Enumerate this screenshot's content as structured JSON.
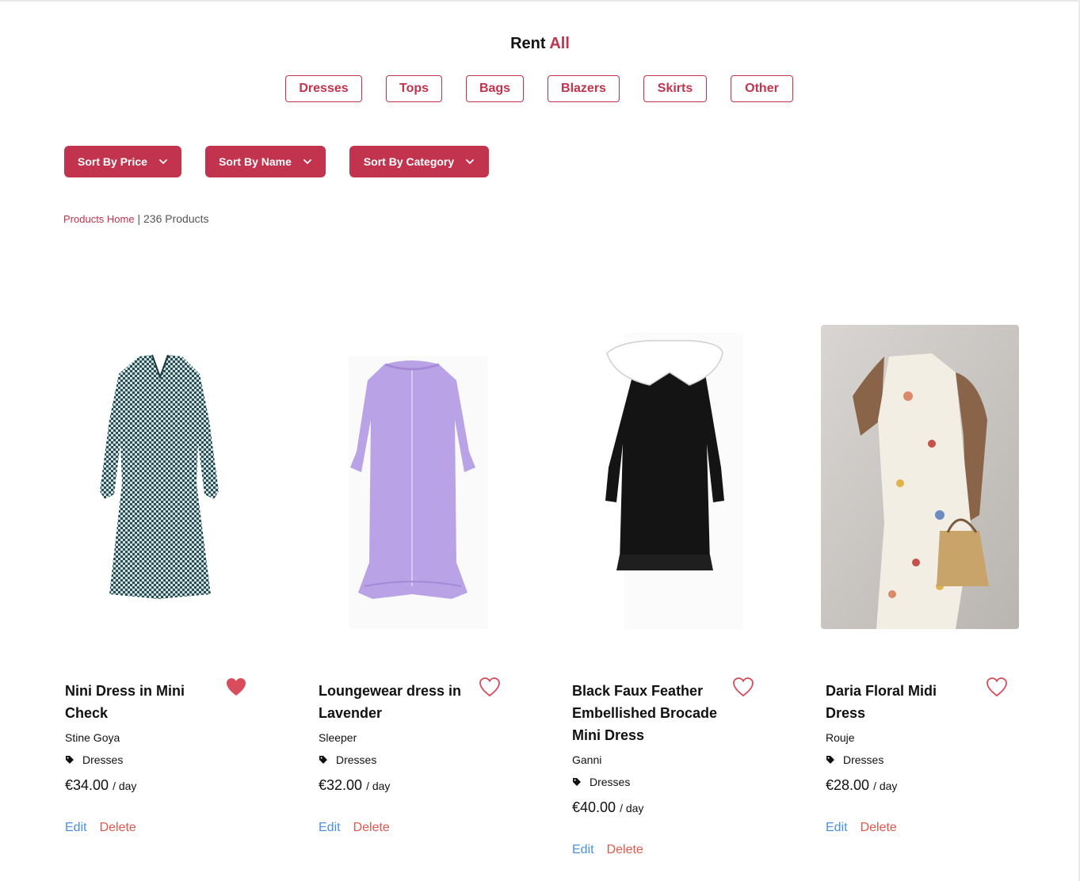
{
  "header": {
    "title_prefix": "Rent",
    "title_accent": "All"
  },
  "categories": [
    "Dresses",
    "Tops",
    "Bags",
    "Blazers",
    "Skirts",
    "Other"
  ],
  "sort": {
    "price": "Sort By Price",
    "name": "Sort By Name",
    "category": "Sort By Category"
  },
  "breadcrumb": {
    "home": "Products Home",
    "separator": "|",
    "count": "236 Products"
  },
  "colors": {
    "accent": "#c2334d",
    "edit": "#4a90e2",
    "delete": "#e2574c"
  },
  "products": [
    {
      "name": "Nini Dress in Mini Check",
      "brand": "Stine Goya",
      "category": "Dresses",
      "price": "€34.00",
      "per": "/ day",
      "favorited": true,
      "edit": "Edit",
      "delete": "Delete"
    },
    {
      "name": "Loungewear dress in Lavender",
      "brand": "Sleeper",
      "category": "Dresses",
      "price": "€32.00",
      "per": "/ day",
      "favorited": false,
      "edit": "Edit",
      "delete": "Delete"
    },
    {
      "name": "Black Faux Feather Embellished Brocade Mini Dress",
      "brand": "Ganni",
      "category": "Dresses",
      "price": "€40.00",
      "per": "/ day",
      "favorited": false,
      "edit": "Edit",
      "delete": "Delete"
    },
    {
      "name": "Daria Floral Midi Dress",
      "brand": "Rouje",
      "category": "Dresses",
      "price": "€28.00",
      "per": "/ day",
      "favorited": false,
      "edit": "Edit",
      "delete": "Delete"
    }
  ]
}
